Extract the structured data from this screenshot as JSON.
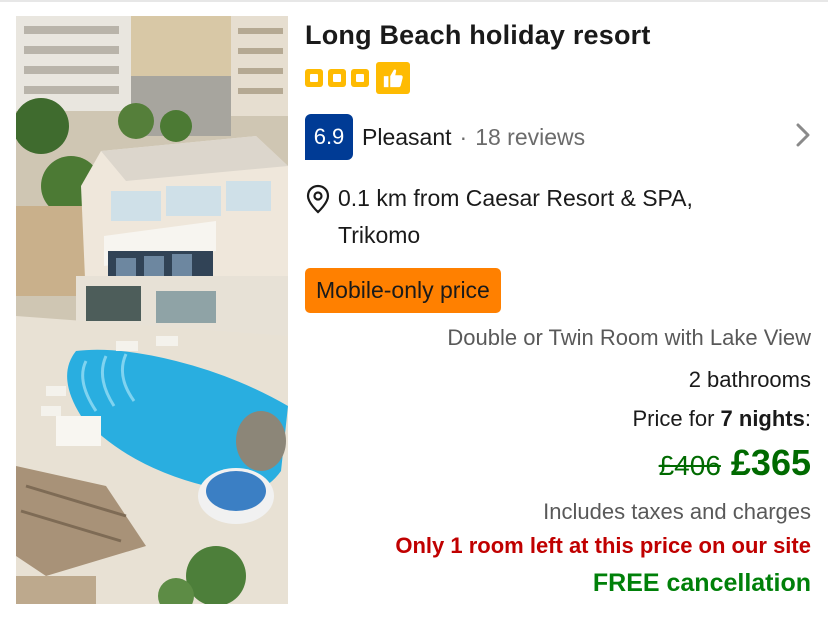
{
  "hotel": {
    "name": "Long Beach holiday resort",
    "star_rating": 3,
    "thumbs_up_badge": "thumbs-up-icon"
  },
  "review": {
    "score": "6.9",
    "score_word": "Pleasant",
    "separator": "·",
    "count": "18 reviews"
  },
  "location": {
    "text": "0.1 km from Caesar Resort & SPA, Trikomo"
  },
  "badge": {
    "mobile_only": "Mobile-only price"
  },
  "room": {
    "type": "Double or Twin Room with Lake View",
    "bathrooms": "2 bathrooms"
  },
  "price": {
    "label_prefix": "Price for ",
    "nights": "7 nights",
    "label_suffix": ":",
    "original": "£406",
    "current": "£365",
    "taxes_note": "Includes taxes and charges"
  },
  "alerts": {
    "scarcity": "Only 1 room left at this price on our site",
    "cancellation": "FREE cancellation"
  },
  "colors": {
    "star_yellow": "#febb02",
    "score_blue": "#003b95",
    "mobile_orange": "#ff8000",
    "price_green": "#006a00",
    "alert_red": "#c00000"
  }
}
